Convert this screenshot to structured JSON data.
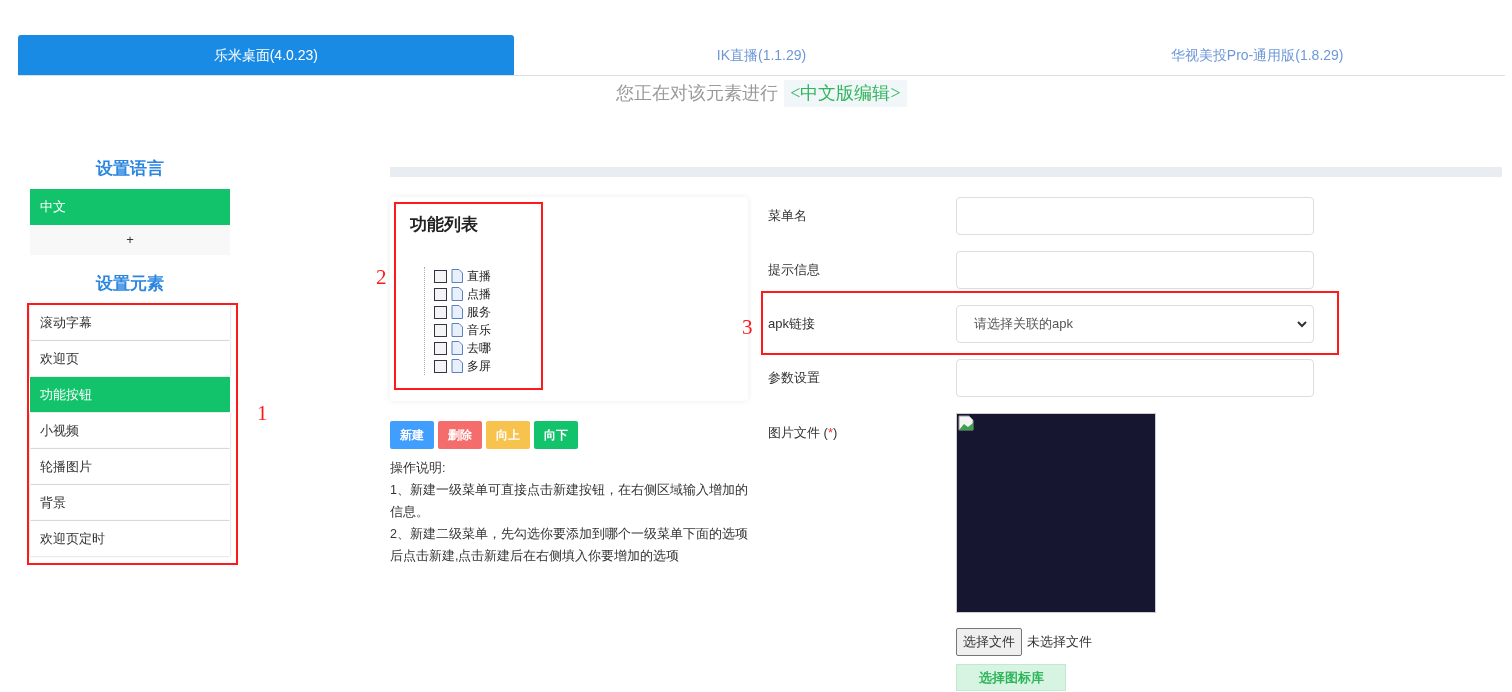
{
  "tabs": [
    {
      "label": "乐米桌面(4.0.23)",
      "selected": true
    },
    {
      "label": "IK直播(1.1.29)",
      "selected": false
    },
    {
      "label": "华视美投Pro-通用版(1.8.29)",
      "selected": false
    }
  ],
  "editing_notice": {
    "text": "您正在对该元素进行",
    "badge": "<中文版编辑>"
  },
  "sidebar": {
    "language_heading": "设置语言",
    "languages": [
      {
        "label": "中文",
        "selected": true
      }
    ],
    "add_label": "+",
    "elements_heading": "设置元素",
    "elements": [
      {
        "label": "滚动字幕",
        "selected": false
      },
      {
        "label": "欢迎页",
        "selected": false
      },
      {
        "label": "功能按钮",
        "selected": true
      },
      {
        "label": "小视频",
        "selected": false
      },
      {
        "label": "轮播图片",
        "selected": false
      },
      {
        "label": "背景",
        "selected": false
      },
      {
        "label": "欢迎页定时",
        "selected": false
      }
    ]
  },
  "function_list": {
    "title": "功能列表",
    "items": [
      {
        "label": "直播",
        "checked": false
      },
      {
        "label": "点播",
        "checked": false
      },
      {
        "label": "服务",
        "checked": false
      },
      {
        "label": "音乐",
        "checked": false
      },
      {
        "label": "去哪",
        "checked": false
      },
      {
        "label": "多屏",
        "checked": false
      }
    ]
  },
  "actions": [
    {
      "label": "新建",
      "color": "#409eff"
    },
    {
      "label": "删除",
      "color": "#f56c6c"
    },
    {
      "label": "向上",
      "color": "#f7c24e"
    },
    {
      "label": "向下",
      "color": "#13c36b"
    }
  ],
  "instructions": [
    "操作说明:",
    "1、新建一级菜单可直接点击新建按钮，在右侧区域输入增加的信息。",
    "2、新建二级菜单，先勾选你要添加到哪个一级菜单下面的选项后点击新建,点击新建后在右侧填入你要增加的选项"
  ],
  "form": {
    "fields": [
      {
        "kind": "text",
        "label": "菜单名"
      },
      {
        "kind": "text",
        "label": "提示信息"
      },
      {
        "kind": "select",
        "label": "apk链接",
        "value": "请选择关联的apk"
      },
      {
        "kind": "text",
        "label": "参数设置"
      }
    ],
    "image": {
      "label": "图片文件 (",
      "required_mark": "*",
      "label_end": ")",
      "file_button": "选择文件",
      "file_status": "未选择文件",
      "library_button": "选择图标库"
    }
  },
  "annotations": [
    {
      "label": "1"
    },
    {
      "label": "2"
    },
    {
      "label": "3"
    }
  ]
}
